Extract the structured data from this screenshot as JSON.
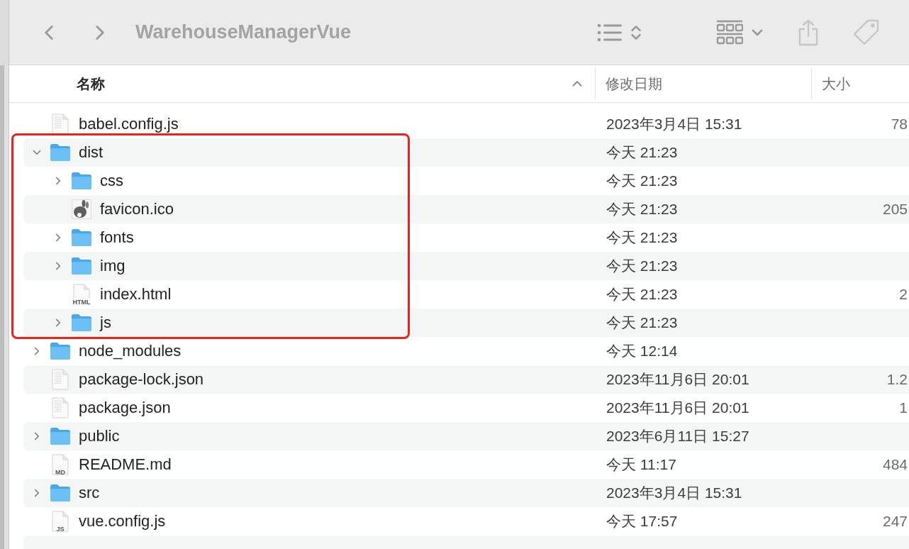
{
  "toolbar": {
    "title": "WarehouseManagerVue"
  },
  "columns": [
    {
      "label": "名称",
      "sorted": true
    },
    {
      "label": "修改日期",
      "sorted": false
    },
    {
      "label": "大小",
      "sorted": false
    }
  ],
  "files": [
    {
      "name": "babel.config.js",
      "kind": "doc",
      "date": "2023年3月4日 15:31",
      "size": "78"
    },
    {
      "name": "dist",
      "kind": "folder",
      "expanded": true,
      "highlighted": true,
      "date": "今天 21:23",
      "children": [
        {
          "name": "css",
          "kind": "folder",
          "expanded": false,
          "date": "今天 21:23"
        },
        {
          "name": "favicon.ico",
          "kind": "image",
          "date": "今天 21:23",
          "size": "205"
        },
        {
          "name": "fonts",
          "kind": "folder",
          "expanded": false,
          "date": "今天 21:23"
        },
        {
          "name": "img",
          "kind": "folder",
          "expanded": false,
          "date": "今天 21:23"
        },
        {
          "name": "index.html",
          "kind": "doc",
          "badge": "HTML",
          "date": "今天 21:23",
          "size": "2"
        },
        {
          "name": "js",
          "kind": "folder",
          "expanded": false,
          "date": "今天 21:23"
        }
      ]
    },
    {
      "name": "node_modules",
      "kind": "folder",
      "expanded": false,
      "date": "今天 12:14"
    },
    {
      "name": "package-lock.json",
      "kind": "doc",
      "date": "2023年11月6日 20:01",
      "size": "1.2"
    },
    {
      "name": "package.json",
      "kind": "doc",
      "date": "2023年11月6日 20:01",
      "size": "1"
    },
    {
      "name": "public",
      "kind": "folder",
      "expanded": false,
      "date": "2023年6月11日 15:27"
    },
    {
      "name": "README.md",
      "kind": "doc",
      "badge": "MD",
      "date": "今天 11:17",
      "size": "484"
    },
    {
      "name": "src",
      "kind": "folder",
      "expanded": false,
      "date": "2023年3月4日 15:31"
    },
    {
      "name": "vue.config.js",
      "kind": "doc",
      "badge": "JS",
      "date": "今天 17:57",
      "size": "247"
    }
  ]
}
